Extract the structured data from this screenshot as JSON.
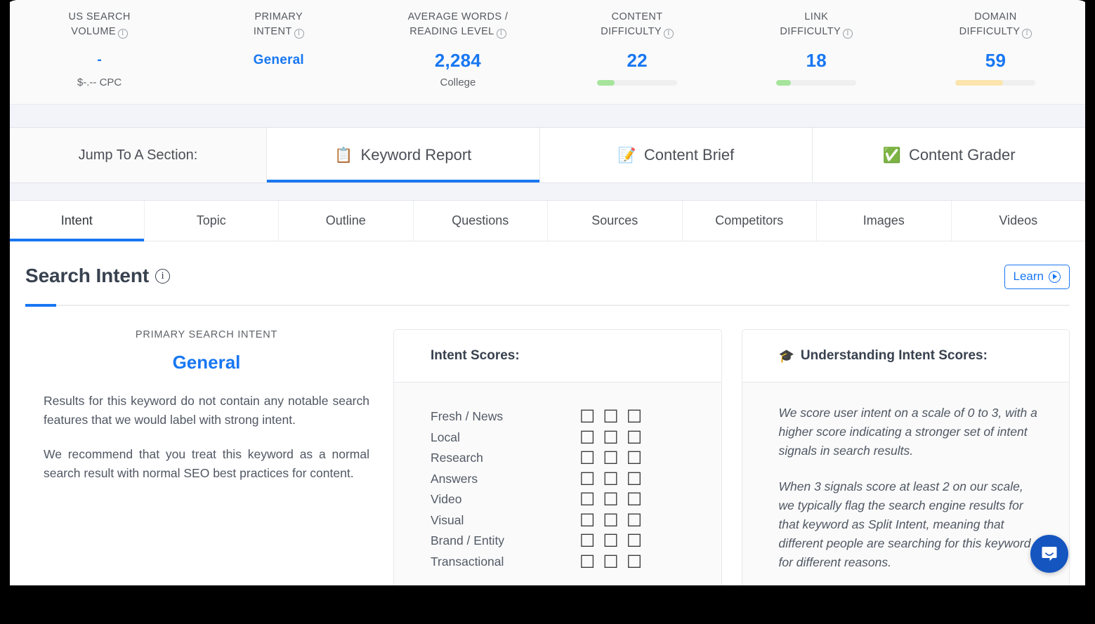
{
  "metrics": [
    {
      "label": "US Search\nVolume",
      "value": "-",
      "value_size": "small",
      "sub": "$-.-- CPC",
      "has_bar": false,
      "bar_pct": 0,
      "bar_color": ""
    },
    {
      "label": "Primary\nIntent",
      "value": "General",
      "value_size": "small",
      "sub": "",
      "has_bar": false,
      "bar_pct": 0,
      "bar_color": ""
    },
    {
      "label": "Average Words /\nReading Level",
      "value": "2,284",
      "value_size": "big",
      "sub": "College",
      "has_bar": false,
      "bar_pct": 0,
      "bar_color": ""
    },
    {
      "label": "Content\nDifficulty",
      "value": "22",
      "value_size": "big",
      "sub": "",
      "has_bar": true,
      "bar_pct": 22,
      "bar_color": "#a6e49c"
    },
    {
      "label": "Link\nDifficulty",
      "value": "18",
      "value_size": "big",
      "sub": "",
      "has_bar": true,
      "bar_pct": 18,
      "bar_color": "#a6e49c"
    },
    {
      "label": "Domain\nDifficulty",
      "value": "59",
      "value_size": "big",
      "sub": "",
      "has_bar": true,
      "bar_pct": 59,
      "bar_color": "#fbe5ad"
    }
  ],
  "jump": {
    "label": "Jump To A Section:",
    "tabs": [
      {
        "label": "Keyword Report",
        "icon": "📋",
        "icon_name": "clipboard-icon",
        "active": true
      },
      {
        "label": "Content Brief",
        "icon": "📝",
        "icon_name": "memo-icon",
        "active": false
      },
      {
        "label": "Content Grader",
        "icon": "✅",
        "icon_name": "check-mark-box-icon",
        "active": false
      }
    ]
  },
  "subtabs": [
    {
      "label": "Intent",
      "active": true
    },
    {
      "label": "Topic",
      "active": false
    },
    {
      "label": "Outline",
      "active": false
    },
    {
      "label": "Questions",
      "active": false
    },
    {
      "label": "Sources",
      "active": false
    },
    {
      "label": "Competitors",
      "active": false
    },
    {
      "label": "Images",
      "active": false
    },
    {
      "label": "Videos",
      "active": false
    }
  ],
  "section": {
    "title": "Search Intent",
    "learn_label": "Learn"
  },
  "left_panel": {
    "eyebrow": "PRIMARY SEARCH INTENT",
    "primary_intent": "General",
    "paragraph_1": "Results for this keyword do not contain any notable search features that we would label with strong intent.",
    "paragraph_2": "We recommend that you treat this keyword as a normal search result with normal SEO best practices for content."
  },
  "intent_scores_card": {
    "title": "Intent Scores:",
    "box_glyph": "☐",
    "rows": [
      {
        "label": "Fresh / News",
        "score": 0,
        "max": 3
      },
      {
        "label": "Local",
        "score": 0,
        "max": 3
      },
      {
        "label": "Research",
        "score": 0,
        "max": 3
      },
      {
        "label": "Answers",
        "score": 0,
        "max": 3
      },
      {
        "label": "Video",
        "score": 0,
        "max": 3
      },
      {
        "label": "Visual",
        "score": 0,
        "max": 3
      },
      {
        "label": "Brand / Entity",
        "score": 0,
        "max": 3
      },
      {
        "label": "Transactional",
        "score": 0,
        "max": 3
      }
    ]
  },
  "understanding_card": {
    "icon": "🎓",
    "title": "Understanding Intent Scores:",
    "paragraph_1": "We score user intent on a scale of 0 to 3, with a higher score indicating a stronger set of intent signals in search results.",
    "paragraph_2": "When 3 signals score at least 2 on our scale, we typically flag the search engine results for that keyword as Split Intent, meaning that different people are searching for this keyword for different reasons."
  },
  "colors": {
    "accent": "#1877f2",
    "green": "#a6e49c",
    "amber": "#fbe5ad",
    "intercom": "#1455c0"
  }
}
